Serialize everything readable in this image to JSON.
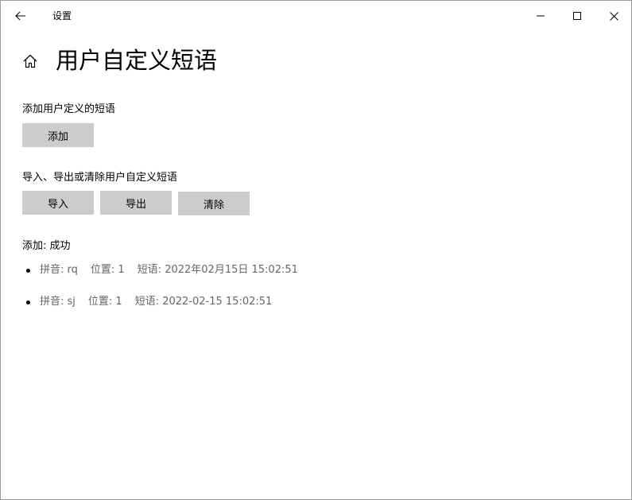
{
  "window": {
    "title": "设置"
  },
  "header": {
    "title": "用户自定义短语"
  },
  "add_section": {
    "label": "添加用户定义的短语",
    "add_button": "添加"
  },
  "io_section": {
    "label": "导入、导出或清除用户自定义短语",
    "import_button": "导入",
    "export_button": "导出",
    "clear_button": "清除"
  },
  "status": {
    "text": "添加: 成功"
  },
  "entries": [
    {
      "pinyin": "拼音: rq",
      "position": "位置: 1",
      "phrase": "短语: 2022年02月15日 15:02:51"
    },
    {
      "pinyin": "拼音: sj",
      "position": "位置: 1",
      "phrase": "短语: 2022-02-15 15:02:51"
    }
  ],
  "icons": {
    "back": "back-arrow-icon",
    "minimize": "minimize-icon",
    "maximize": "maximize-icon",
    "close": "close-icon",
    "home": "home-icon"
  }
}
